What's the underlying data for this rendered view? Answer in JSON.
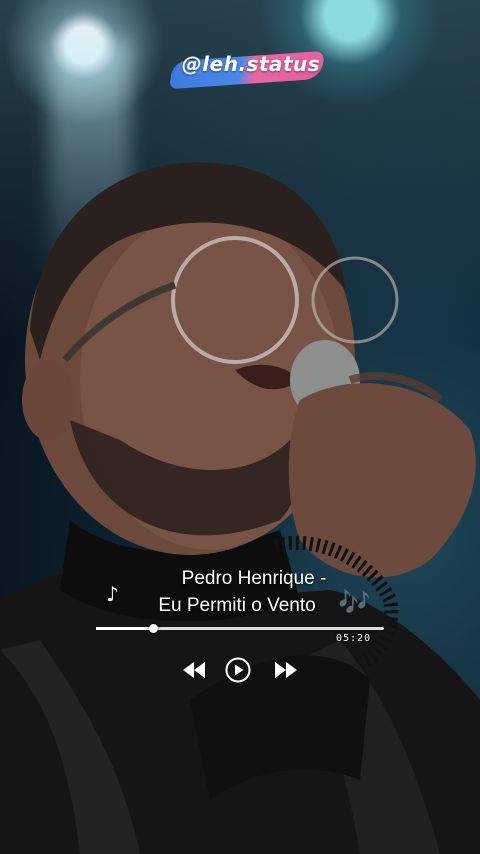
{
  "watermark": {
    "text": "@leh.status"
  },
  "track": {
    "artist_line": "Pedro Henrique -",
    "title_line": "Eu Permiti o Vento",
    "note_left": "♪",
    "note_right": "🎶"
  },
  "player": {
    "time": "05:20",
    "progress_fraction": 0.2,
    "controls": {
      "rewind_icon": "rewind-icon",
      "play_icon": "play-icon",
      "forward_icon": "fast-forward-icon"
    }
  },
  "colors": {
    "accent_blue": "#4c8cf0",
    "accent_pink": "#ef5fa0",
    "note_purple": "#a48be3"
  }
}
